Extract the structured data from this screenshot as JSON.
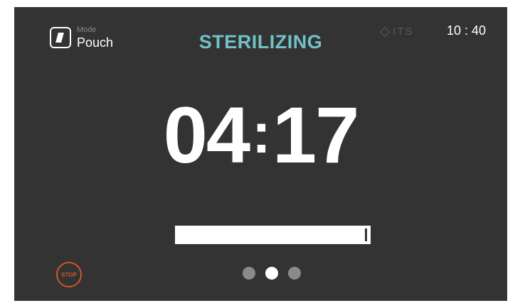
{
  "header": {
    "mode_label": "Mode",
    "mode_value": "Pouch",
    "status": "STERILIZING",
    "brand": "ITS",
    "clock": "10 : 40"
  },
  "timer": {
    "minutes": "04",
    "separator": ":",
    "seconds": "17"
  },
  "progress": {
    "fraction": 0.97
  },
  "controls": {
    "stop_label": "STOP"
  },
  "pagination": {
    "pages": 3,
    "active_index": 1
  },
  "colors": {
    "background": "#333333",
    "status_accent": "#6fc3c8",
    "stop_accent": "#d2552a",
    "text": "#ffffff"
  },
  "icons": {
    "mode": "pouch-icon",
    "brand": "its-logo-icon"
  }
}
